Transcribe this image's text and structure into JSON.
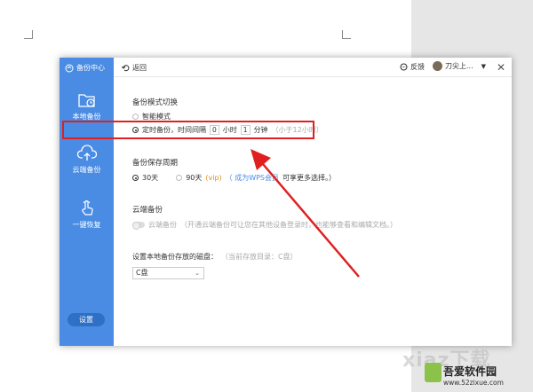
{
  "sidebar": {
    "title": "备份中心",
    "items": [
      {
        "label": "本地备份",
        "icon": "folder-clock-icon"
      },
      {
        "label": "云端备份",
        "icon": "cloud-upload-icon"
      },
      {
        "label": "一键恢复",
        "icon": "hand-touch-icon"
      }
    ],
    "settings_label": "设置"
  },
  "topbar": {
    "back_label": "返回",
    "feedback_label": "反馈",
    "username": "刀尖上...",
    "close_glyph": "✕"
  },
  "mode": {
    "title": "备份模式切换",
    "smart_label": "智能模式",
    "timed_label": "定时备份，时间间隔",
    "hours_value": "0",
    "hours_unit": "小时",
    "minutes_value": "1",
    "minutes_unit": "分钟",
    "hint": "（小于12小时）"
  },
  "period": {
    "title": "备份保存周期",
    "opt30": "30天",
    "opt90": "90天",
    "vip": "(vip)",
    "note_link": "（ 成为WPS会员",
    "note_rest": "可享更多选择。）"
  },
  "cloud": {
    "title": "云端备份",
    "toggle_label": "云端备份",
    "desc": "（开通云端备份可让您在其他设备登录时，也能够查看和编辑文档。）"
  },
  "disk": {
    "title": "设置本地备份存放的磁盘：",
    "current": "（当前存放目录：C盘）",
    "selected": "C盘"
  },
  "watermark": {
    "ghost": "xiaz下载",
    "name": "吾爱软件园",
    "url": "www.52zixue.com"
  },
  "colors": {
    "sidebar": "#4a8ce3",
    "highlight": "#e02020"
  }
}
